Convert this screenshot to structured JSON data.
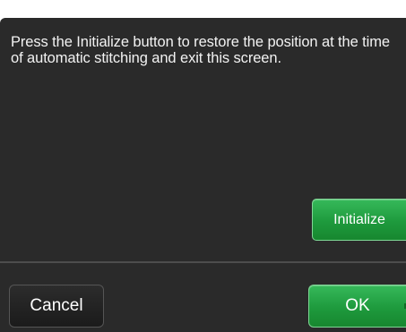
{
  "dialog": {
    "message": "Press the Initialize button to restore the position at the time of automatic stitching and exit this screen.",
    "initialize_label": "Initialize",
    "cancel_label": "Cancel",
    "ok_label": "OK"
  },
  "colors": {
    "dialog_background": "#2a2a2a",
    "accent_green": "#1e9a3d",
    "text": "#f2f2f2"
  }
}
